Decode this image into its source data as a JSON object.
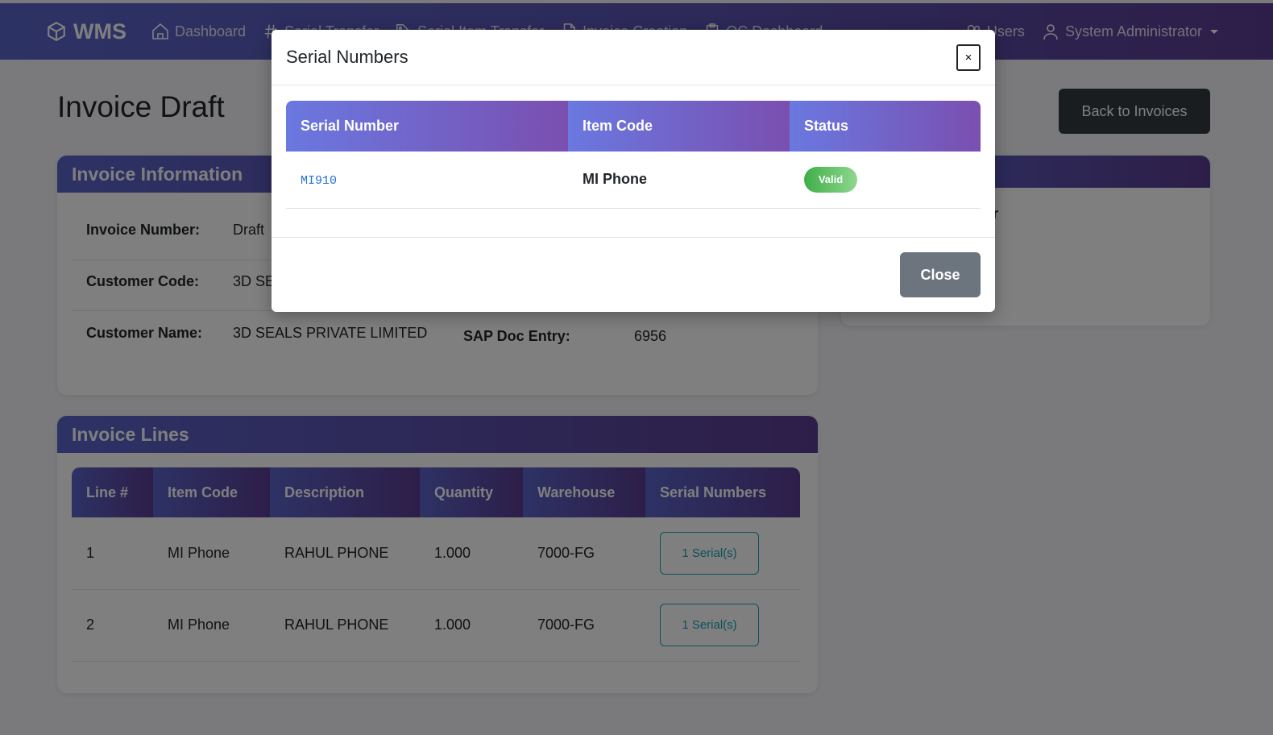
{
  "nav": {
    "brand": "WMS",
    "items": [
      {
        "label": "Dashboard",
        "icon": "home-icon"
      },
      {
        "label": "Serial Transfer",
        "icon": "hash-icon"
      },
      {
        "label": "Serial Item Transfer",
        "icon": "tag-icon"
      },
      {
        "label": "Invoice Creation",
        "icon": "document-icon"
      },
      {
        "label": "QC Dashboard",
        "icon": "clipboard-icon"
      }
    ],
    "users": "Users",
    "user_menu": "System Administrator"
  },
  "page": {
    "title": "Invoice Draft",
    "back_button": "Back to Invoices"
  },
  "invoice_info": {
    "header": "Invoice Information",
    "invoice_number_label": "Invoice Number:",
    "invoice_number": "Draft",
    "customer_code_label": "Customer Code:",
    "customer_code": "3D SE",
    "customer_name_label": "Customer Name:",
    "customer_name": "3D SEALS PRIVATE LIMITED",
    "sap_doc_entry_label": "SAP Doc Entry:",
    "sap_doc_entry": "6956"
  },
  "side_card": {
    "partial_text": "r"
  },
  "invoice_lines": {
    "header": "Invoice Lines",
    "columns": [
      "Line #",
      "Item Code",
      "Description",
      "Quantity",
      "Warehouse",
      "Serial Numbers"
    ],
    "rows": [
      {
        "line": "1",
        "item_code": "MI Phone",
        "description": "RAHUL PHONE",
        "quantity": "1.000",
        "warehouse": "7000-FG",
        "serials": "1 Serial(s)"
      },
      {
        "line": "2",
        "item_code": "MI Phone",
        "description": "RAHUL PHONE",
        "quantity": "1.000",
        "warehouse": "7000-FG",
        "serials": "1 Serial(s)"
      }
    ]
  },
  "modal": {
    "title": "Serial Numbers",
    "close_x": "×",
    "columns": [
      "Serial Number",
      "Item Code",
      "Status"
    ],
    "rows": [
      {
        "serial": "MI910",
        "item_code": "MI Phone",
        "status": "Valid"
      }
    ],
    "close_button": "Close"
  }
}
